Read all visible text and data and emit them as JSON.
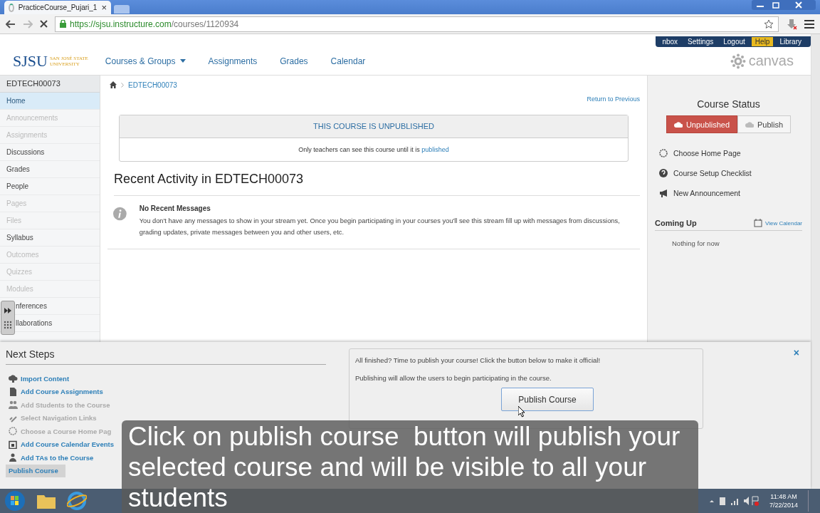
{
  "browser": {
    "tab_title": "PracticeCourse_Pujari_1",
    "tab_close": "×",
    "url_host": "https://sjsu.instructure.com",
    "url_path": "/courses/1120934"
  },
  "top_links": [
    {
      "label": "nbox",
      "highlighted": false
    },
    {
      "label": "Settings",
      "highlighted": false
    },
    {
      "label": "Logout",
      "highlighted": false
    },
    {
      "label": "Help",
      "highlighted": true
    },
    {
      "label": "Library",
      "highlighted": false
    }
  ],
  "logo": {
    "mark": "SJSU",
    "line1": "SAN JOSÉ STATE",
    "line2": "UNIVERSITY"
  },
  "nav": [
    {
      "label": "Courses & Groups",
      "dropdown": true
    },
    {
      "label": "Assignments",
      "dropdown": false
    },
    {
      "label": "Grades",
      "dropdown": false
    },
    {
      "label": "Calendar",
      "dropdown": false
    }
  ],
  "canvas_logo": "canvas",
  "sidebar": {
    "course": "EDTECH00073",
    "items": [
      {
        "label": "Home",
        "selected": true,
        "disabled": false,
        "covered": false
      },
      {
        "label": "Announcements",
        "selected": false,
        "disabled": true,
        "covered": false
      },
      {
        "label": "Assignments",
        "selected": false,
        "disabled": true,
        "covered": false
      },
      {
        "label": "Discussions",
        "selected": false,
        "disabled": false,
        "covered": false
      },
      {
        "label": "Grades",
        "selected": false,
        "disabled": false,
        "covered": false
      },
      {
        "label": "People",
        "selected": false,
        "disabled": false,
        "covered": false
      },
      {
        "label": "Pages",
        "selected": false,
        "disabled": true,
        "covered": false
      },
      {
        "label": "Files",
        "selected": false,
        "disabled": true,
        "covered": false
      },
      {
        "label": "Syllabus",
        "selected": false,
        "disabled": false,
        "covered": false
      },
      {
        "label": "Outcomes",
        "selected": false,
        "disabled": true,
        "covered": false
      },
      {
        "label": "Quizzes",
        "selected": false,
        "disabled": true,
        "covered": false
      },
      {
        "label": "Modules",
        "selected": false,
        "disabled": true,
        "covered": false
      },
      {
        "label": "nferences",
        "selected": false,
        "disabled": false,
        "covered": true
      },
      {
        "label": "llaborations",
        "selected": false,
        "disabled": false,
        "covered": true
      }
    ]
  },
  "breadcrumb": "EDTECH00073",
  "return_link": "Return to Previous",
  "notice": {
    "title": "THIS COURSE IS UNPUBLISHED",
    "text": "Only teachers can see this course until it is ",
    "link": "published"
  },
  "activity": {
    "heading": "Recent Activity in EDTECH00073",
    "title": "No Recent Messages",
    "body": "You don't have any messages to show in your stream yet. Once you begin participating in your courses you'll see this stream fill up with messages from discussions, grading updates, private messages between you and other users, etc."
  },
  "course_status": {
    "heading": "Course Status",
    "buttons": [
      {
        "label": "Unpublished",
        "selected": true
      },
      {
        "label": "Publish",
        "selected": false
      }
    ],
    "actions": [
      {
        "label": "Choose Home Page",
        "kind": "circle"
      },
      {
        "label": "Course Setup Checklist",
        "kind": "question"
      },
      {
        "label": "New Announcement",
        "kind": "megaphone"
      }
    ]
  },
  "coming_up": {
    "heading": "Coming Up",
    "link": "View Calendar",
    "empty": "Nothing for now"
  },
  "next_steps": {
    "heading": "Next Steps",
    "close": "×",
    "items": [
      {
        "label": "Import Content",
        "kind": "cloud",
        "disabled": false,
        "selected": false
      },
      {
        "label": "Add Course Assignments",
        "kind": "doc",
        "disabled": false,
        "selected": false
      },
      {
        "label": "Add Students to the Course",
        "kind": "people",
        "disabled": true,
        "selected": false
      },
      {
        "label": "Select Navigation Links",
        "kind": "link",
        "disabled": true,
        "selected": false
      },
      {
        "label": "Choose a Course Home Pag",
        "kind": "circle",
        "disabled": true,
        "selected": false
      },
      {
        "label": "Add Course Calendar Events",
        "kind": "calendar",
        "disabled": false,
        "selected": false
      },
      {
        "label": "Add TAs to the Course",
        "kind": "person",
        "disabled": false,
        "selected": false
      },
      {
        "label": "Publish Course",
        "kind": "plain",
        "disabled": false,
        "selected": true
      }
    ],
    "publish_box": {
      "line1": "All finished? Time to publish your course! Click the button below to make it official!",
      "line2": "Publishing will allow the users to begin participating in the course.",
      "button": "Publish Course"
    }
  },
  "caption": "Click on publish course  button will publish your selected course and will be visible to all your students",
  "taskbar": {
    "time": "11:48 AM",
    "date": "7/22/2014"
  }
}
